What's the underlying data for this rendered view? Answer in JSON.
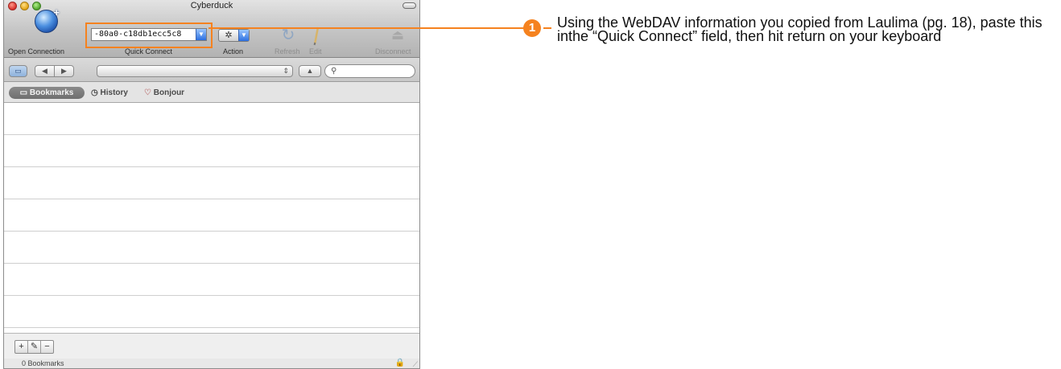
{
  "window": {
    "title": "Cyberduck"
  },
  "toolbar": {
    "open_connection_label": "Open Connection",
    "quick_connect_label": "Quick Connect",
    "quick_connect_value": "-80a0-c18db1ecc5c8",
    "action_label": "Action",
    "refresh_label": "Refresh",
    "edit_label": "Edit",
    "disconnect_label": "Disconnect"
  },
  "navbar": {
    "back_glyph": "◀",
    "forward_glyph": "▶",
    "up_glyph": "▲",
    "search_value": ""
  },
  "tabs": [
    {
      "label": "Bookmarks",
      "icon": "book-icon",
      "active": true
    },
    {
      "label": "History",
      "icon": "clock-icon",
      "active": false
    },
    {
      "label": "Bonjour",
      "icon": "bonjour-icon",
      "active": false
    }
  ],
  "bookmark_list": {
    "rows": [
      "",
      "",
      "",
      "",
      "",
      "",
      ""
    ]
  },
  "bottom_tools": {
    "add": "+",
    "edit": "✎",
    "remove": "−"
  },
  "status": {
    "text": "0 Bookmarks"
  },
  "annotation": {
    "number": "1",
    "text": "Using the WebDAV information you copied from Laulima (pg. 18), paste this inthe “Quick Connect” field, then hit return on your keyboard",
    "color": "#f5821f"
  }
}
